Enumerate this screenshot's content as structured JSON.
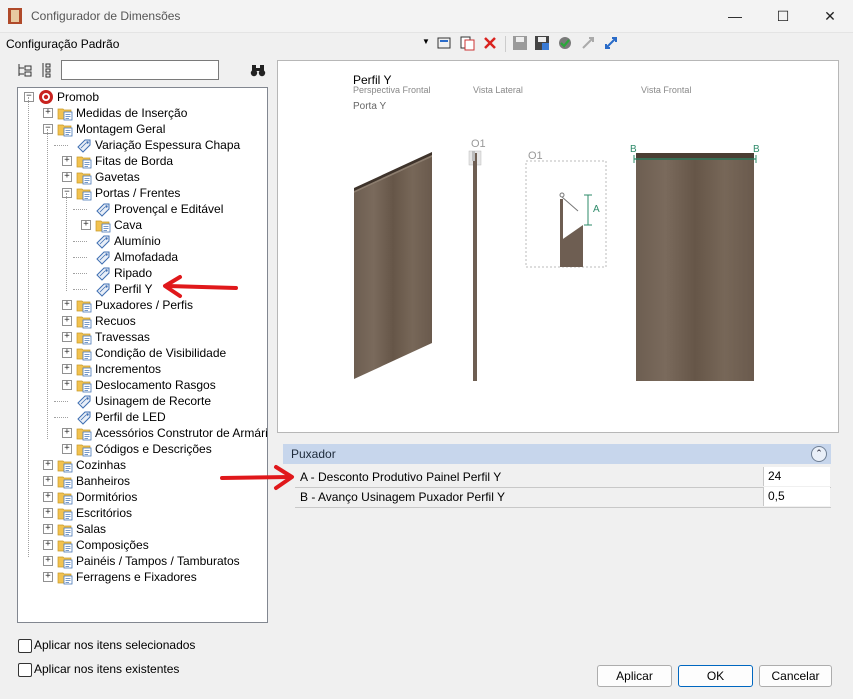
{
  "window": {
    "title": "Configurador de Dimensões"
  },
  "config": {
    "label": "Configuração Padrão"
  },
  "tree_search": {
    "value": ""
  },
  "tree": [
    {
      "label": "Promob"
    },
    {
      "label": "Medidas de Inserção"
    },
    {
      "label": "Montagem Geral"
    },
    {
      "label": "Variação Espessura Chapa"
    },
    {
      "label": "Fitas de Borda"
    },
    {
      "label": "Gavetas"
    },
    {
      "label": "Portas / Frentes"
    },
    {
      "label": "Provençal e Editável"
    },
    {
      "label": "Cava"
    },
    {
      "label": "Alumínio"
    },
    {
      "label": "Almofadada"
    },
    {
      "label": "Ripado"
    },
    {
      "label": "Perfil Y"
    },
    {
      "label": "Puxadores / Perfis"
    },
    {
      "label": "Recuos"
    },
    {
      "label": "Travessas"
    },
    {
      "label": "Condição de Visibilidade"
    },
    {
      "label": "Incrementos"
    },
    {
      "label": "Deslocamento Rasgos"
    },
    {
      "label": "Usinagem de Recorte"
    },
    {
      "label": "Perfil de LED"
    },
    {
      "label": "Acessórios Construtor de Armários"
    },
    {
      "label": "Códigos e Descrições"
    },
    {
      "label": "Cozinhas"
    },
    {
      "label": "Banheiros"
    },
    {
      "label": "Dormitórios"
    },
    {
      "label": "Escritórios"
    },
    {
      "label": "Salas"
    },
    {
      "label": "Composições"
    },
    {
      "label": "Painéis / Tampos / Tamburatos"
    },
    {
      "label": "Ferragens e Fixadores"
    }
  ],
  "preview": {
    "title": "Perfil Y",
    "view_perspective": "Perspectiva Frontal",
    "view_lateral": "Vista Lateral",
    "view_frontal": "Vista Frontal",
    "subtitle": "Porta Y",
    "marker_o1_a": "O1",
    "marker_o1_b": "O1",
    "marker_a": "A",
    "marker_b_left": "B",
    "marker_b_right": "B"
  },
  "properties": {
    "group": "Puxador",
    "rows": [
      {
        "label": "A - Desconto Produtivo Painel Perfil Y",
        "value": "24"
      },
      {
        "label": "B - Avanço Usinagem Puxador Perfil Y",
        "value": "0,5"
      }
    ]
  },
  "options": {
    "apply_selected": "Aplicar nos itens selecionados",
    "apply_existing": "Aplicar nos itens existentes"
  },
  "buttons": {
    "apply": "Aplicar",
    "ok": "OK",
    "cancel": "Cancelar"
  },
  "colors": {
    "wood": "#6e5e52",
    "wood_dark": "#4a3d33",
    "header_blue": "#c7d6ec",
    "arrow_red": "#e0181b",
    "dimension_green": "#2e8b6a"
  }
}
